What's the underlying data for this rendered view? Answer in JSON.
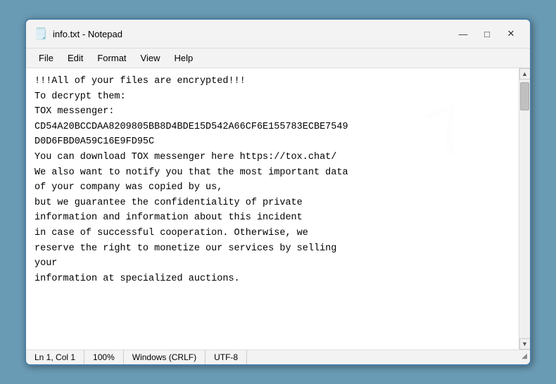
{
  "titleBar": {
    "icon": "📄",
    "title": "info.txt - Notepad",
    "minimize": "—",
    "maximize": "□",
    "close": "✕"
  },
  "menuBar": {
    "items": [
      "File",
      "Edit",
      "Format",
      "View",
      "Help"
    ]
  },
  "content": {
    "lines": [
      "!!!All of your files are encrypted!!!",
      "To decrypt them:",
      "TOX messenger:",
      "CD54A20BCCDAA8209805BB8D4BDE15D542A66CF6E155783ECBE7549",
      "D0D6FBD0A59C16E9FD95C",
      "You can download TOX messenger here https://tox.chat/",
      "We also want to notify you that the most important data",
      "of your company was copied by us,",
      "but we guarantee the confidentiality of private",
      "information and information about this incident",
      "in case of successful cooperation. Otherwise, we",
      "reserve the right to monetize our services by selling",
      "your",
      "information at specialized auctions."
    ]
  },
  "statusBar": {
    "position": "Ln 1, Col 1",
    "zoom": "100%",
    "lineEnding": "Windows (CRLF)",
    "encoding": "UTF-8"
  }
}
